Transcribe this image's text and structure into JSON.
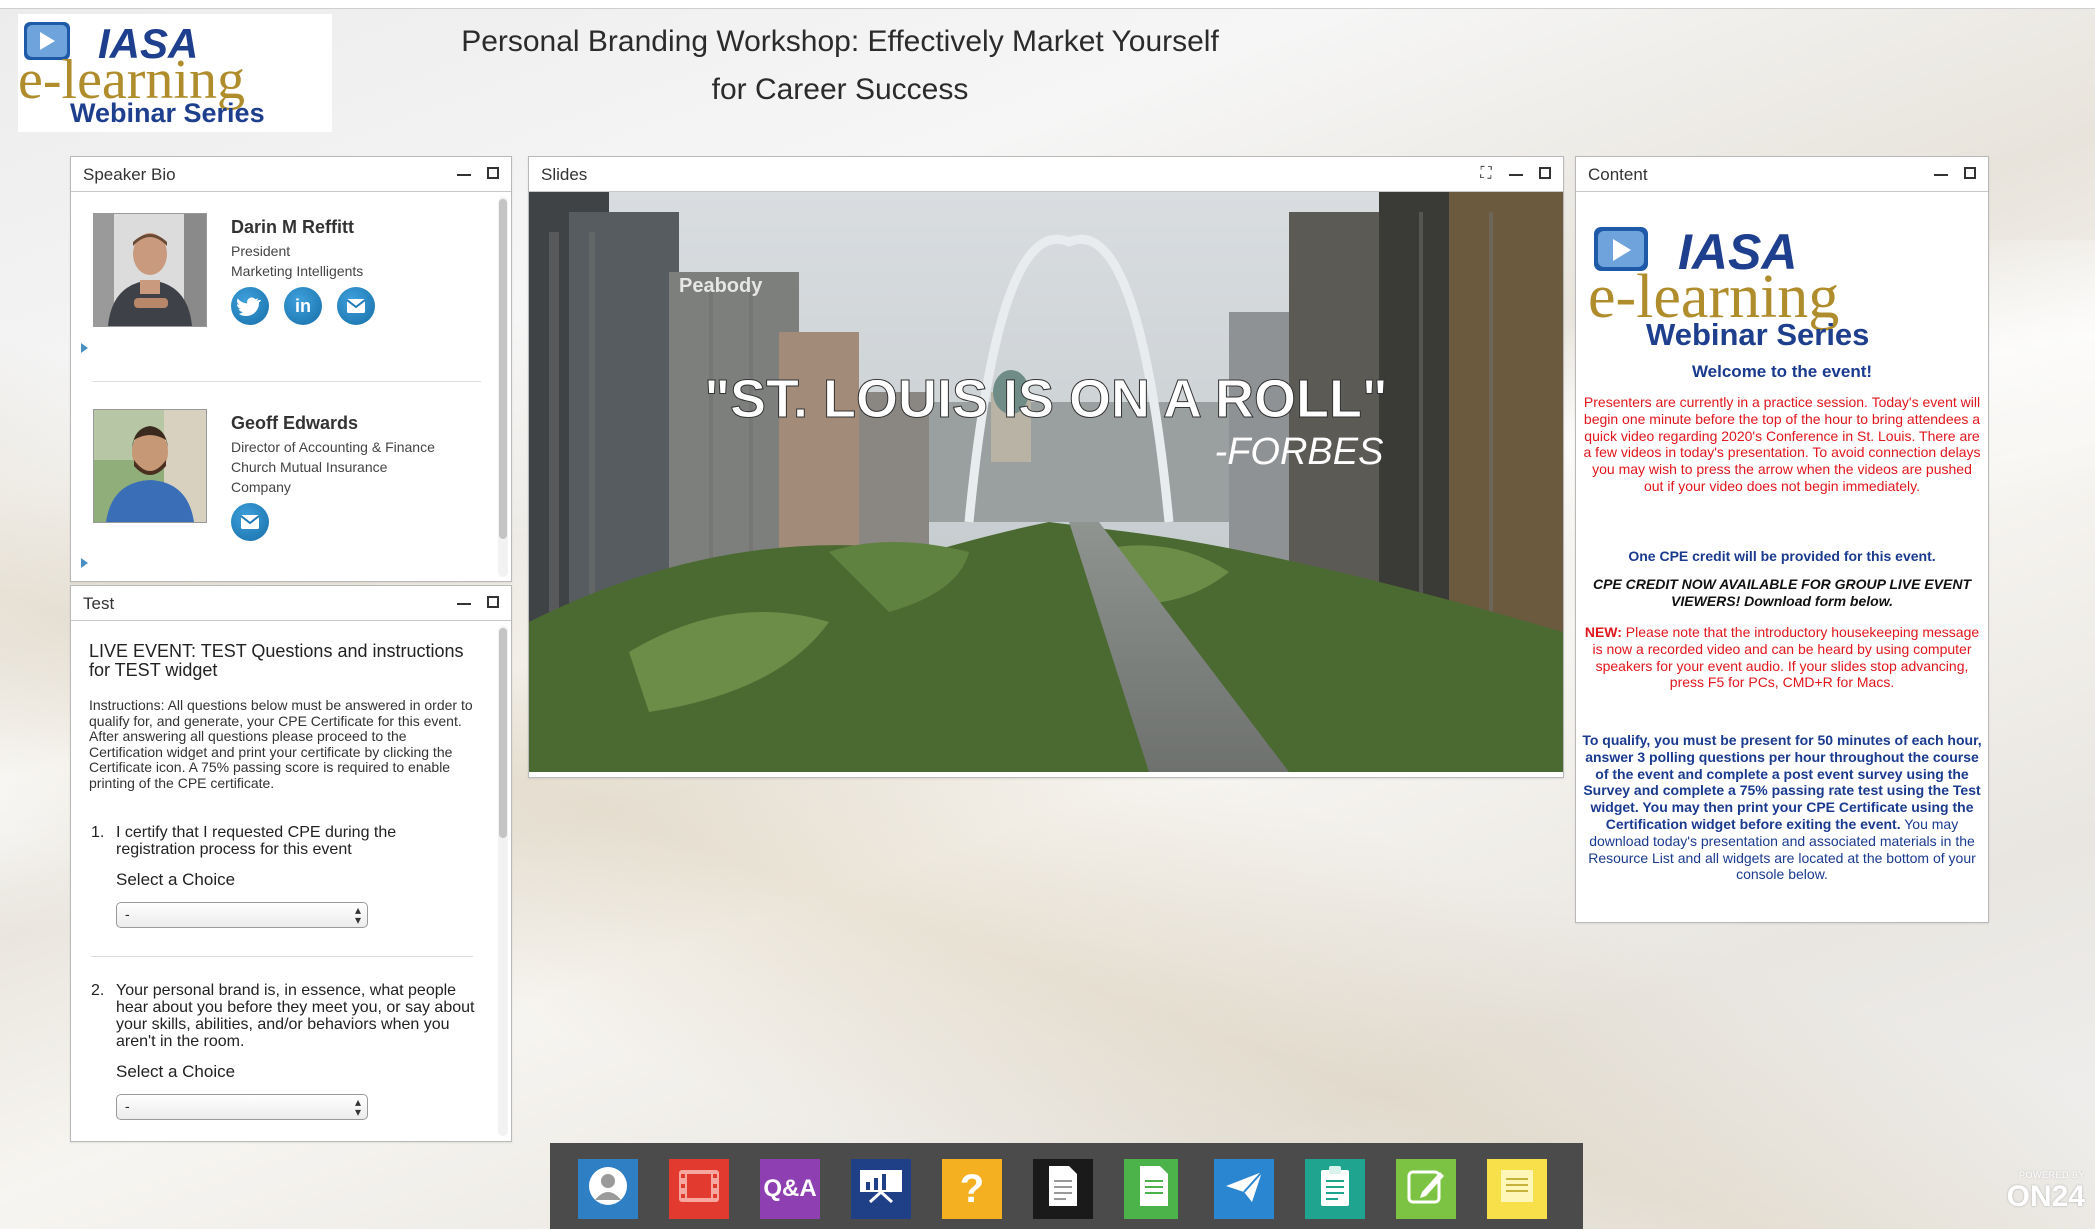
{
  "header": {
    "title_line1": "Personal Branding Workshop: Effectively Market Yourself",
    "title_line2": "for Career Success"
  },
  "logo": {
    "brand": "IASA",
    "line1": "e-learning",
    "line2": "Webinar Series"
  },
  "speaker_bio": {
    "title": "Speaker Bio",
    "speakers": [
      {
        "name": "Darin M Reffitt",
        "lines": [
          "President",
          "Marketing Intelligents"
        ]
      },
      {
        "name": "Geoff Edwards",
        "lines": [
          "Director of Accounting & Finance",
          "Church Mutual Insurance",
          "Company"
        ]
      }
    ]
  },
  "test": {
    "title": "Test",
    "heading": "LIVE EVENT: TEST Questions and instructions for TEST widget",
    "instructions": "Instructions: All questions below must be answered in order to qualify for, and generate, your CPE Certificate for this event.  After answering all questions please proceed to the Certification widget and print your certificate by clicking the Certificate icon.  A 75% passing score is required to enable printing of the CPE certificate.",
    "questions": [
      {
        "number": "1.",
        "text": "I certify that I requested CPE during the registration process for this event",
        "select_label": "Select a Choice",
        "value": "-"
      },
      {
        "number": "2.",
        "text": "Your personal brand is, in essence, what people hear about you before they meet you, or say about your skills, abilities, and/or behaviors when you aren't in the room.",
        "select_label": "Select a Choice",
        "value": "-"
      }
    ]
  },
  "slides": {
    "title": "Slides",
    "quote": "\"ST. LOUIS IS ON A ROLL\"",
    "attribution": "-FORBES",
    "building_sign": "Peabody"
  },
  "content": {
    "title": "Content",
    "welcome": "Welcome to the event!",
    "practice_note": "Presenters are currently in a practice session.  Today's event will begin one minute before the top of the hour to bring attendees a quick video regarding 2020's Conference in St. Louis.  There are a few videos in today's presentation.  To avoid connection delays you may wish to press the arrow when the videos are pushed out if your video does not begin immediately.",
    "cpe_credit": "One CPE credit will be provided for this event.",
    "group_live": "CPE CREDIT NOW AVAILABLE FOR GROUP LIVE EVENT VIEWERS! Download form below.",
    "new_label": "NEW:",
    "new_note": " Please note that the introductory housekeeping message is now a recorded video and can be heard by using computer speakers for your event audio. If your slides stop advancing, press F5 for PCs, CMD+R for Macs.",
    "qualify_bold": "To qualify, you must be present for 50 minutes of each hour, answer 3 polling questions per hour throughout the course of the event and complete a post event survey using the Survey and complete a 75% passing rate test using the Test widget. You may then print your CPE Certificate using the Certification widget before exiting the event.",
    "qualify_normal": " You may download today's presentation and associated materials in the Resource List and all widgets are located at the bottom of your console below."
  },
  "dock": {
    "qa_label": "Q&A",
    "help_label": "?",
    "items": [
      {
        "name": "speaker-bio",
        "icon": "person-icon",
        "color": "#2f7fc4"
      },
      {
        "name": "media",
        "icon": "film-icon",
        "color": "#e23a2e"
      },
      {
        "name": "qa",
        "icon": "qa-icon",
        "color": "#8e3fb1"
      },
      {
        "name": "slides",
        "icon": "presentation-icon",
        "color": "#1f3f86"
      },
      {
        "name": "help",
        "icon": "question-icon",
        "color": "#f4b021"
      },
      {
        "name": "document",
        "icon": "document-icon",
        "color": "#1a1a1a"
      },
      {
        "name": "resources",
        "icon": "sheet-icon",
        "color": "#4bb34a"
      },
      {
        "name": "email",
        "icon": "envelope-icon",
        "color": "#2a86d1"
      },
      {
        "name": "survey",
        "icon": "clipboard-icon",
        "color": "#1fa58f"
      },
      {
        "name": "test",
        "icon": "edit-icon",
        "color": "#7cc243"
      },
      {
        "name": "notes",
        "icon": "notes-icon",
        "color": "#f7e04a"
      }
    ]
  },
  "footer": {
    "powered_by": "POWERED BY",
    "brand": "ON24"
  }
}
